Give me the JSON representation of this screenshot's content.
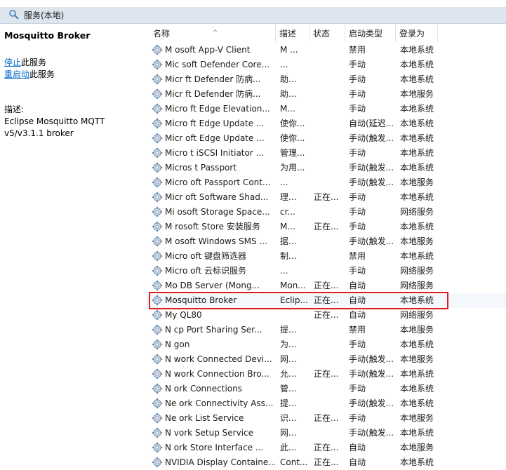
{
  "window": {
    "title": "服务(本地)",
    "icon": "gear-icon"
  },
  "left_pane": {
    "service_name": "Mosquitto Broker",
    "stop_link": "停止",
    "stop_suffix": "此服务",
    "restart_link": "重启动",
    "restart_suffix": "此服务",
    "description_label": "描述:",
    "description_line1": "Eclipse Mosquitto MQTT",
    "description_line2": "v5/v3.1.1 broker"
  },
  "columns": {
    "name": "名称",
    "desc": "描述",
    "status": "状态",
    "startup": "启动类型",
    "logon": "登录为"
  },
  "colors": {
    "highlight_border": "#d9201f",
    "link": "#0066cc"
  },
  "rows": [
    {
      "name": "M     osoft App-V Client",
      "desc": "M   ...",
      "status": "",
      "startup": "禁用",
      "logon": "本地系统"
    },
    {
      "name": "Mic    soft Defender Core...",
      "desc": "  ...",
      "status": "",
      "startup": "手动",
      "logon": "本地系统"
    },
    {
      "name": "Micr    ft Defender 防病...",
      "desc": "  助...",
      "status": "",
      "startup": "手动",
      "logon": "本地系统"
    },
    {
      "name": "Micr    ft Defender 防病...",
      "desc": "  助...",
      "status": "",
      "startup": "手动",
      "logon": "本地服务"
    },
    {
      "name": "Micro    ft Edge Elevation...",
      "desc": "  M...",
      "status": "",
      "startup": "手动",
      "logon": "本地系统"
    },
    {
      "name": "Micro    ft Edge Update ...",
      "desc": "  使你...",
      "status": "",
      "startup": "自动(延迟...",
      "logon": "本地系统"
    },
    {
      "name": "Micr    oft Edge Update ...",
      "desc": "  使你...",
      "status": "",
      "startup": "手动(触发...",
      "logon": "本地系统"
    },
    {
      "name": "Micro    t iSCSI Initiator ...",
      "desc": "  管理...",
      "status": "",
      "startup": "手动",
      "logon": "本地系统"
    },
    {
      "name": "Micros    t Passport",
      "desc": "  为用...",
      "status": "",
      "startup": "手动(触发...",
      "logon": "本地系统"
    },
    {
      "name": "Micro    oft Passport Cont...",
      "desc": "  ...",
      "status": "",
      "startup": "手动(触发...",
      "logon": "本地服务"
    },
    {
      "name": "Micr    oft Software Shad...",
      "desc": "  理...",
      "status": "正在...",
      "startup": "手动",
      "logon": "本地系统"
    },
    {
      "name": "Mi    osoft Storage Space...",
      "desc": "  cr...",
      "status": "",
      "startup": "手动",
      "logon": "网络服务"
    },
    {
      "name": "M    rosoft Store 安装服务",
      "desc": "  M...",
      "status": "正在...",
      "startup": "手动",
      "logon": "本地系统"
    },
    {
      "name": "M    osoft Windows SMS ...",
      "desc": "  据...",
      "status": "",
      "startup": "手动(触发...",
      "logon": "本地服务"
    },
    {
      "name": "Micro    oft 键盘筛选器",
      "desc": "  制...",
      "status": "",
      "startup": "禁用",
      "logon": "本地系统"
    },
    {
      "name": "Micro    oft 云标识服务",
      "desc": "  ...",
      "status": "",
      "startup": "手动",
      "logon": "网络服务"
    },
    {
      "name": "Mo      DB Server (Mong...",
      "desc": "Mon...",
      "status": "正在...",
      "startup": "自动",
      "logon": "网络服务"
    },
    {
      "name": "Mosquitto Broker",
      "desc": "Eclip...",
      "status": "正在...",
      "startup": "自动",
      "logon": "本地系统"
    },
    {
      "name": "My    QL80",
      "desc": "",
      "status": "正在...",
      "startup": "自动",
      "logon": "网络服务"
    },
    {
      "name": "N     cp Port Sharing Ser...",
      "desc": "  提...",
      "status": "",
      "startup": "禁用",
      "logon": "本地服务"
    },
    {
      "name": "N      gon",
      "desc": "  为...",
      "status": "",
      "startup": "手动",
      "logon": "本地系统"
    },
    {
      "name": "N     work Connected Devi...",
      "desc": "  网...",
      "status": "",
      "startup": "手动(触发...",
      "logon": "本地服务"
    },
    {
      "name": "N     work Connection Bro...",
      "desc": "  允...",
      "status": "正在...",
      "startup": "手动(触发...",
      "logon": "本地系统"
    },
    {
      "name": "N     ork Connections",
      "desc": "  管...",
      "status": "",
      "startup": "手动",
      "logon": "本地系统"
    },
    {
      "name": "Ne     ork Connectivity Ass...",
      "desc": "  提...",
      "status": "",
      "startup": "手动(触发...",
      "logon": "本地系统"
    },
    {
      "name": "Ne     ork List Service",
      "desc": "  识...",
      "status": "正在...",
      "startup": "手动",
      "logon": "本地服务"
    },
    {
      "name": "N     vork Setup Service",
      "desc": "  网...",
      "status": "",
      "startup": "手动(触发...",
      "logon": "本地系统"
    },
    {
      "name": "N     ork Store Interface ...",
      "desc": "  此...",
      "status": "正在...",
      "startup": "自动",
      "logon": "本地服务"
    },
    {
      "name": "NVIDIA Display Containe...",
      "desc": "Cont...",
      "status": "正在...",
      "startup": "自动",
      "logon": "本地系统"
    }
  ]
}
